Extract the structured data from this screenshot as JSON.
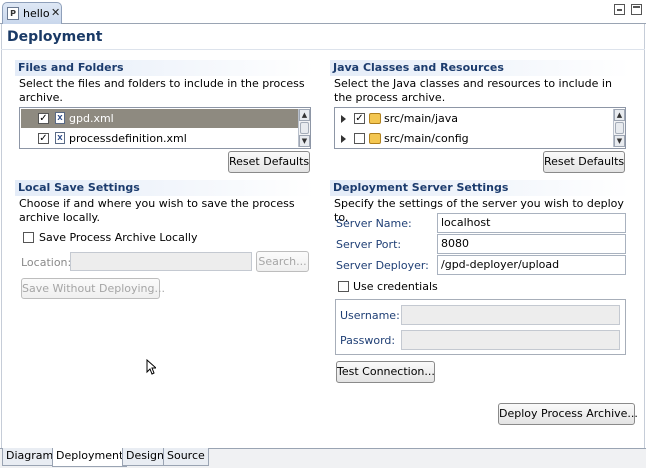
{
  "editor_tab": {
    "title": "hello",
    "icon": "process-file-icon"
  },
  "form": {
    "title": "Deployment"
  },
  "files_section": {
    "title": "Files and Folders",
    "description": "Select the files and folders to include in the process archive.",
    "items": [
      {
        "label": "gpd.xml",
        "checked": true,
        "selected": true
      },
      {
        "label": "processdefinition.xml",
        "checked": true,
        "selected": false
      }
    ],
    "reset_label": "Reset Defaults"
  },
  "java_section": {
    "title": "Java Classes and Resources",
    "description": "Select the Java classes and resources to include in the process archive.",
    "items": [
      {
        "label": "src/main/java",
        "checked": true
      },
      {
        "label": "src/main/config",
        "checked": false
      }
    ],
    "reset_label": "Reset Defaults"
  },
  "local_section": {
    "title": "Local Save Settings",
    "description": "Choose if and where you wish to save the process archive locally.",
    "save_locally_label": "Save Process Archive Locally",
    "location_label": "Location:",
    "location_value": "",
    "search_label": "Search...",
    "save_without_deploying_label": "Save Without Deploying..."
  },
  "server_section": {
    "title": "Deployment Server Settings",
    "description": "Specify the settings of the server you wish to deploy to.",
    "server_name_label": "Server Name:",
    "server_name_value": "localhost",
    "server_port_label": "Server Port:",
    "server_port_value": "8080",
    "server_deployer_label": "Server Deployer:",
    "server_deployer_value": "/gpd-deployer/upload",
    "use_credentials_label": "Use credentials",
    "username_label": "Username:",
    "password_label": "Password:",
    "test_connection_label": "Test Connection...",
    "deploy_label": "Deploy Process Archive..."
  },
  "bottom_tabs": [
    "Diagram",
    "Deployment",
    "Design",
    "Source"
  ],
  "active_bottom_tab": "Deployment",
  "colors": {
    "section_title": "#1c3c6e",
    "selection": "#8e8a80",
    "label_blue": "#1f3f75"
  }
}
